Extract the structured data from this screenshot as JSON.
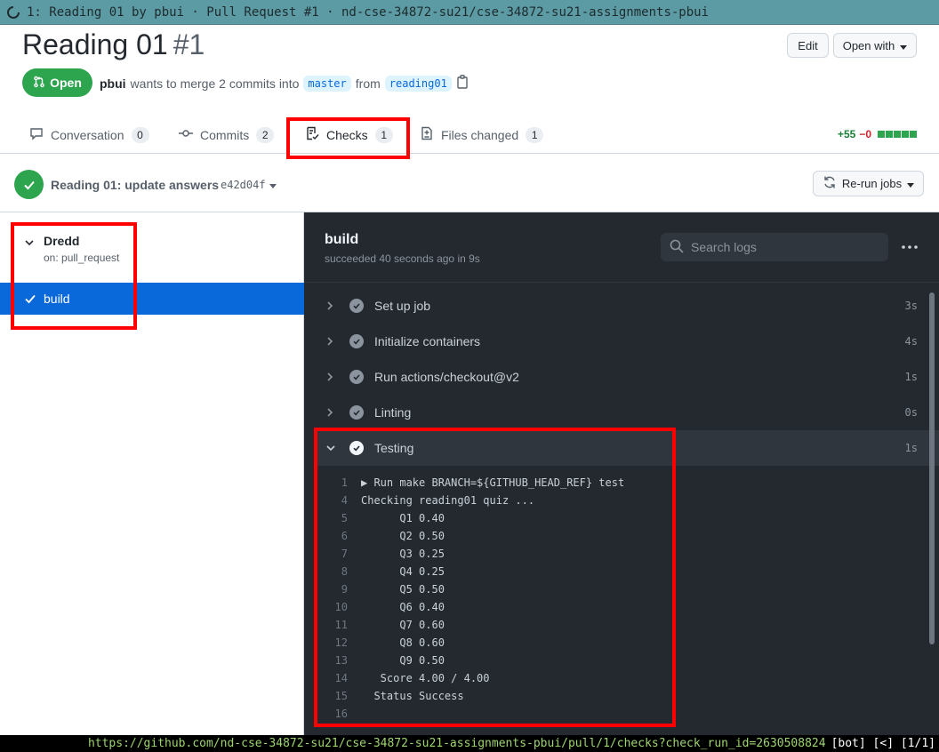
{
  "window": {
    "title": "1: Reading 01 by pbui · Pull Request #1 · nd-cse-34872-su21/cse-34872-su21-assignments-pbui"
  },
  "header": {
    "title": "Reading 01",
    "number": "#1",
    "edit_label": "Edit",
    "open_with_label": "Open with",
    "state_label": "Open",
    "author": "pbui",
    "merge_text": "wants to merge 2 commits into",
    "base_branch": "master",
    "from_text": "from",
    "head_branch": "reading01"
  },
  "tabs": [
    {
      "label": "Conversation",
      "count": "0"
    },
    {
      "label": "Commits",
      "count": "2"
    },
    {
      "label": "Checks",
      "count": "1"
    },
    {
      "label": "Files changed",
      "count": "1"
    }
  ],
  "diffstat": {
    "additions": "+55",
    "deletions": "−0"
  },
  "commit": {
    "title": "Reading 01: update answers",
    "sha": "e42d04f",
    "rerun_label": "Re-run jobs"
  },
  "sidebar": {
    "workflow_name": "Dredd",
    "workflow_trigger": "on: pull_request",
    "job_name": "build"
  },
  "log": {
    "job_title": "build",
    "job_status": "succeeded 40 seconds ago in 9s",
    "search_placeholder": "Search logs",
    "steps": [
      {
        "name": "Set up job",
        "duration": "3s"
      },
      {
        "name": "Initialize containers",
        "duration": "4s"
      },
      {
        "name": "Run actions/checkout@v2",
        "duration": "1s"
      },
      {
        "name": "Linting",
        "duration": "0s"
      },
      {
        "name": "Testing",
        "duration": "1s"
      }
    ],
    "lines": [
      {
        "n": "1",
        "text": "▶ Run make BRANCH=${GITHUB_HEAD_REF} test"
      },
      {
        "n": "4",
        "text": "Checking reading01 quiz ..."
      },
      {
        "n": "5",
        "text": "      Q1 0.40"
      },
      {
        "n": "6",
        "text": "      Q2 0.50"
      },
      {
        "n": "7",
        "text": "      Q3 0.25"
      },
      {
        "n": "8",
        "text": "      Q4 0.25"
      },
      {
        "n": "9",
        "text": "      Q5 0.50"
      },
      {
        "n": "10",
        "text": "      Q6 0.40"
      },
      {
        "n": "11",
        "text": "      Q7 0.60"
      },
      {
        "n": "12",
        "text": "      Q8 0.60"
      },
      {
        "n": "13",
        "text": "      Q9 0.50"
      },
      {
        "n": "14",
        "text": "   Score 4.00 / 4.00"
      },
      {
        "n": "15",
        "text": "  Status Success"
      },
      {
        "n": "16",
        "text": ""
      }
    ]
  },
  "statusline": {
    "url": "https://github.com/nd-cse-34872-su21/cse-34872-su21-assignments-pbui/pull/1/checks?check_run_id=2630508824",
    "mode": "[bot]",
    "nav": "[<]",
    "position": "[1/1]"
  }
}
